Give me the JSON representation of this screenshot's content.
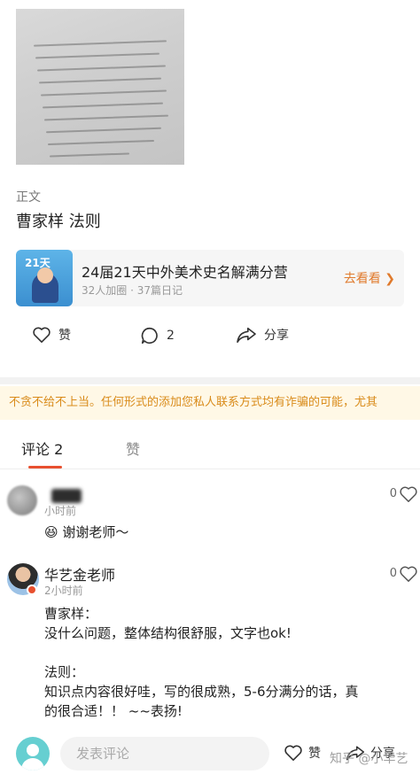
{
  "post": {
    "section_label": "正文",
    "title": "曹家样 法则"
  },
  "camp_card": {
    "thumb_text": "21天",
    "title": "24届21天中外美术史名解满分营",
    "meta": "32人加圈 · 37篇日记",
    "go_label": "去看看 ❯"
  },
  "actions": {
    "like_label": "赞",
    "comment_count": "2",
    "share_label": "分享"
  },
  "warning_text": "不贪不给不上当。任何形式的添加您私人联系方式均有诈骗的可能，尤其",
  "tabs": [
    {
      "label": "评论 2"
    },
    {
      "label": "赞"
    }
  ],
  "comments": [
    {
      "time": "小时前",
      "text": "😆 谢谢老师～",
      "like_count": "0"
    },
    {
      "name": "华艺金老师",
      "time": "2小时前",
      "lines": [
        "曹家样：",
        "没什么问题，整体结构很舒服，文字也ok!",
        "",
        "法则：",
        "知识点内容很好哇，写的很成熟，5-6分满分的话，真",
        "的很合适！！ ~~表扬!"
      ],
      "like_count": "0"
    }
  ],
  "bottom_bar": {
    "input_placeholder": "发表评论",
    "like_label": "赞",
    "share_label": "分享",
    "watermark": "知乎 @小华艺"
  },
  "colors": {
    "accent": "#e8502f",
    "warning_bg": "#fff8e6",
    "warning_text": "#d98b1a",
    "go_link": "#e07a2c"
  }
}
